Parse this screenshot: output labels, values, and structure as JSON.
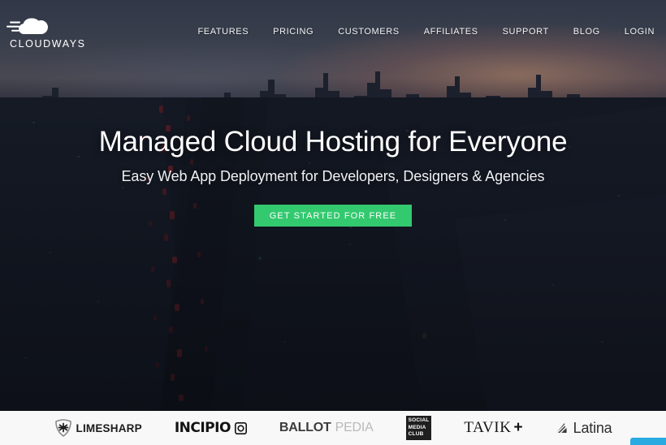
{
  "brand": {
    "logo_text": "CLOUDWAYS",
    "logo_icon": "cloud-speed-icon",
    "accent_green": "#33c96f",
    "chat_blue": "#29abe2"
  },
  "nav": {
    "items": [
      {
        "label": "FEATURES"
      },
      {
        "label": "PRICING"
      },
      {
        "label": "CUSTOMERS"
      },
      {
        "label": "AFFILIATES"
      },
      {
        "label": "SUPPORT"
      },
      {
        "label": "BLOG"
      },
      {
        "label": "LOGIN"
      }
    ]
  },
  "hero": {
    "title": "Managed Cloud Hosting for Everyone",
    "subtitle": "Easy Web App Deployment for Developers, Designers & Agencies",
    "cta_label": "GET STARTED FOR FREE",
    "background_description": "aerial dusk cityscape with skyline silhouette and red traffic trails"
  },
  "clients": {
    "items": [
      {
        "name": "LIMESHARP",
        "icon": "limesharp-star-badge-icon"
      },
      {
        "name": "INCIPIO",
        "icon": "incipio-square-icon"
      },
      {
        "name_bold": "BALLOT",
        "name_light": "PEDIA"
      },
      {
        "line1": "SOCIAL",
        "line2": "MEDIA",
        "line3": "CLUB"
      },
      {
        "name": "TAVIK",
        "suffix": "+"
      },
      {
        "name": "Latina",
        "icon": "latina-striped-triangle-icon"
      }
    ]
  },
  "chat": {
    "label": "chat-widget-tab"
  }
}
